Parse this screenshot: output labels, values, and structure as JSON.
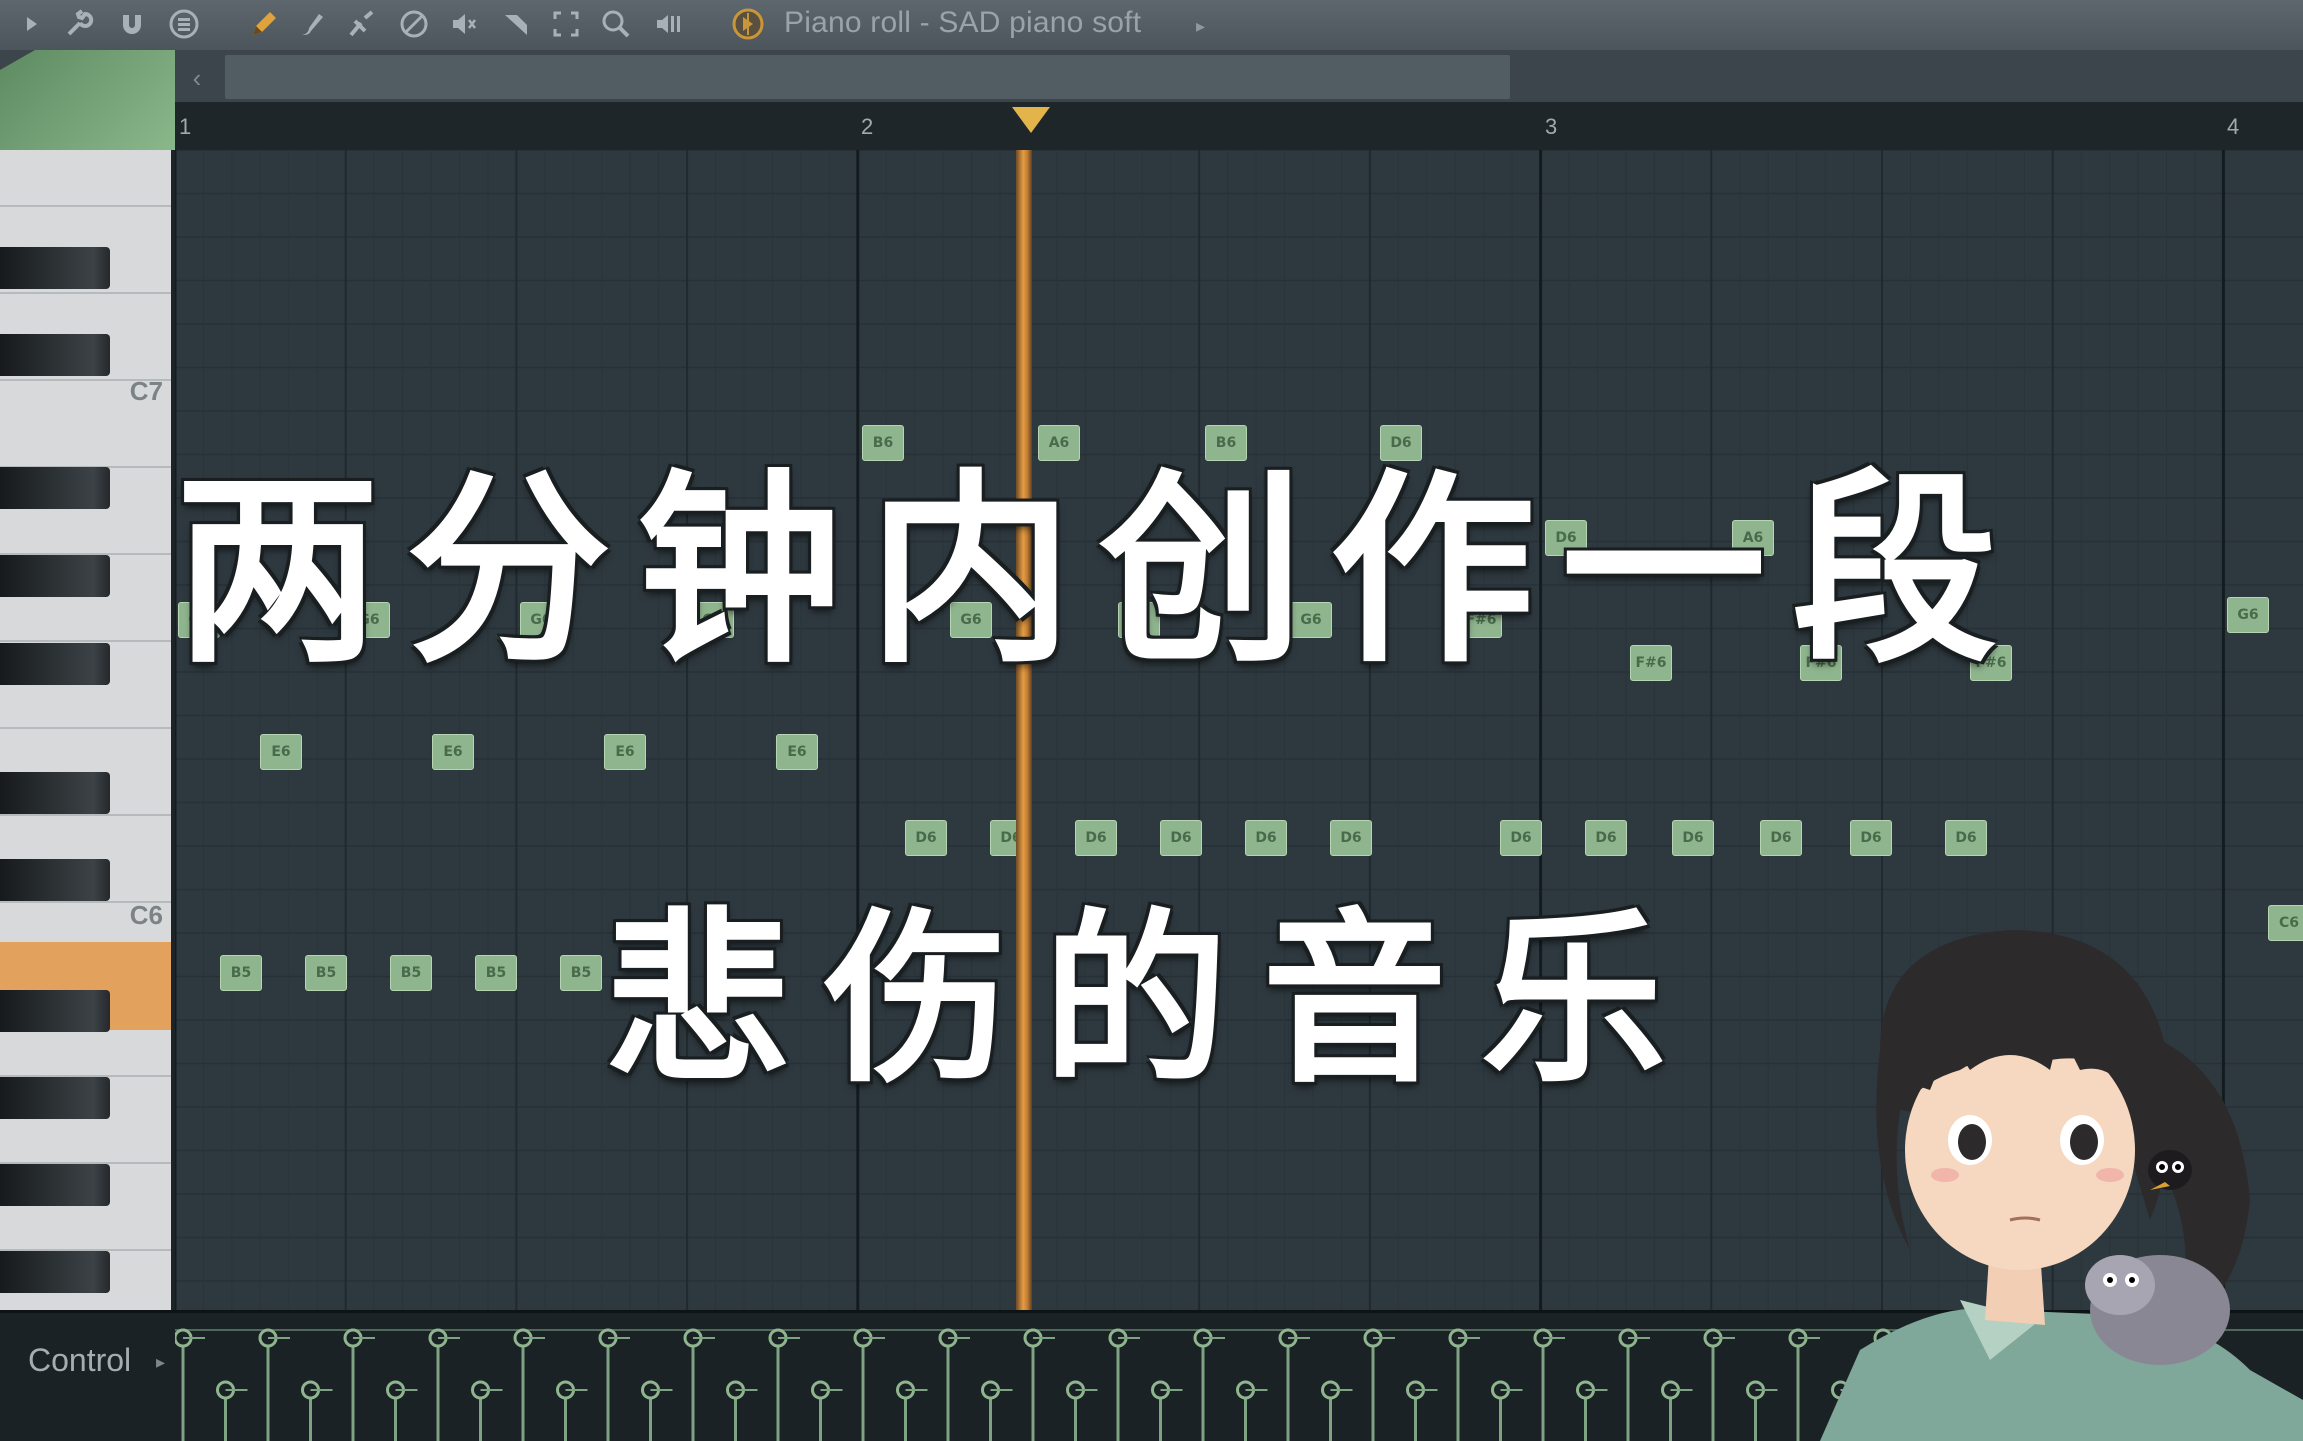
{
  "toolbar": {
    "icons": [
      "play-arrow-icon",
      "wrench-icon",
      "magnet-icon",
      "menu-circle-icon",
      "pencil-icon",
      "brush-icon",
      "delete-icon",
      "mute-icon",
      "mute-volume-icon",
      "slice-icon",
      "select-icon",
      "zoom-icon",
      "playback-icon"
    ],
    "title": "Piano roll - SAD piano soft"
  },
  "ruler": {
    "bars": [
      "1",
      "2",
      "3",
      "4"
    ]
  },
  "keyboard": {
    "labels": {
      "c7": "C7",
      "c6": "C6"
    }
  },
  "notes": [
    {
      "label": "G6"
    },
    {
      "label": "E6"
    },
    {
      "label": "B5"
    },
    {
      "label": "G6"
    },
    {
      "label": "E6"
    },
    {
      "label": "B5"
    },
    {
      "label": "B5"
    },
    {
      "label": "G6"
    },
    {
      "label": "E6"
    },
    {
      "label": "B5"
    },
    {
      "label": "B5"
    },
    {
      "label": "G6"
    },
    {
      "label": "E6"
    },
    {
      "label": "B6"
    },
    {
      "label": "D6"
    },
    {
      "label": "G6"
    },
    {
      "label": "D6"
    },
    {
      "label": "A6"
    },
    {
      "label": "D6"
    },
    {
      "label": "G6"
    },
    {
      "label": "D6"
    },
    {
      "label": "B6"
    },
    {
      "label": "D6"
    },
    {
      "label": "G6"
    },
    {
      "label": "D6"
    },
    {
      "label": "D6"
    },
    {
      "label": "F#6"
    },
    {
      "label": "D6"
    },
    {
      "label": "D6"
    },
    {
      "label": "F#6"
    },
    {
      "label": "D6"
    },
    {
      "label": "A6"
    },
    {
      "label": "F#6"
    },
    {
      "label": "D6"
    },
    {
      "label": "D6"
    },
    {
      "label": "F#6"
    },
    {
      "label": "D6"
    },
    {
      "label": "D6"
    },
    {
      "label": "G6"
    },
    {
      "label": "C6"
    }
  ],
  "control": {
    "label": "Control"
  },
  "overlay": {
    "title_line1": "两分钟内创作一段",
    "title_line2": "悲伤的音乐"
  },
  "colors": {
    "note": "#8fb58e",
    "playhead": "#e59c42",
    "grid": "#2e393f"
  }
}
